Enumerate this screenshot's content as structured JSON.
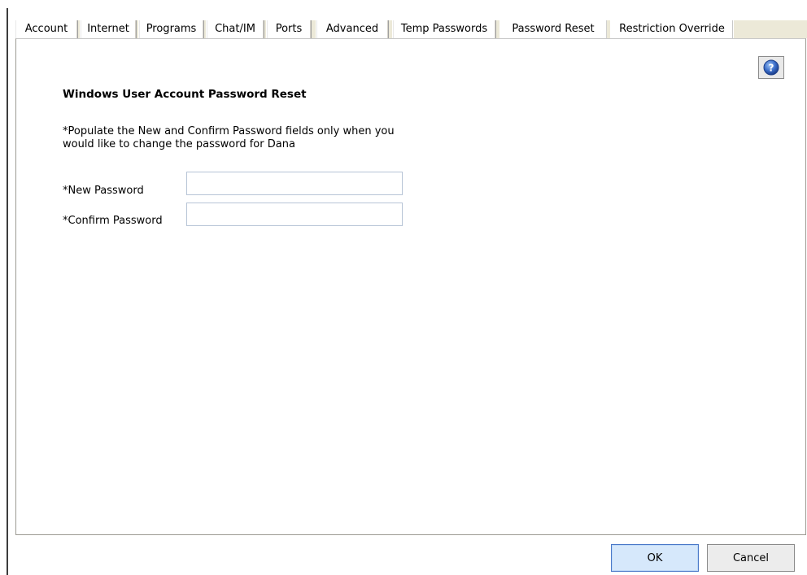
{
  "tabs": [
    {
      "label": "Account",
      "active": false
    },
    {
      "label": "Internet",
      "active": false
    },
    {
      "label": "Programs",
      "active": false
    },
    {
      "label": "Chat/IM",
      "active": false
    },
    {
      "label": "Ports",
      "active": false
    },
    {
      "label": "Advanced",
      "active": false
    },
    {
      "label": "Temp Passwords",
      "active": false
    },
    {
      "label": "Password Reset",
      "active": true
    },
    {
      "label": "Restriction Override",
      "active": false
    }
  ],
  "panel": {
    "heading": "Windows User Account Password Reset",
    "note_line1": "*Populate the New and Confirm Password fields only when you",
    "note_line2": "would like to change the password for Dana",
    "new_password": {
      "label": "*New Password",
      "value": ""
    },
    "confirm_password": {
      "label": "*Confirm Password",
      "value": ""
    },
    "help_icon": "help-question-icon"
  },
  "buttons": {
    "ok_label": "OK",
    "cancel_label": "Cancel"
  },
  "colors": {
    "tabstrip_bg": "#ece9d8",
    "ok_border": "#4a78c8",
    "ok_bg": "#d6e8fb",
    "help_icon_blue": "#3a6cc8"
  }
}
